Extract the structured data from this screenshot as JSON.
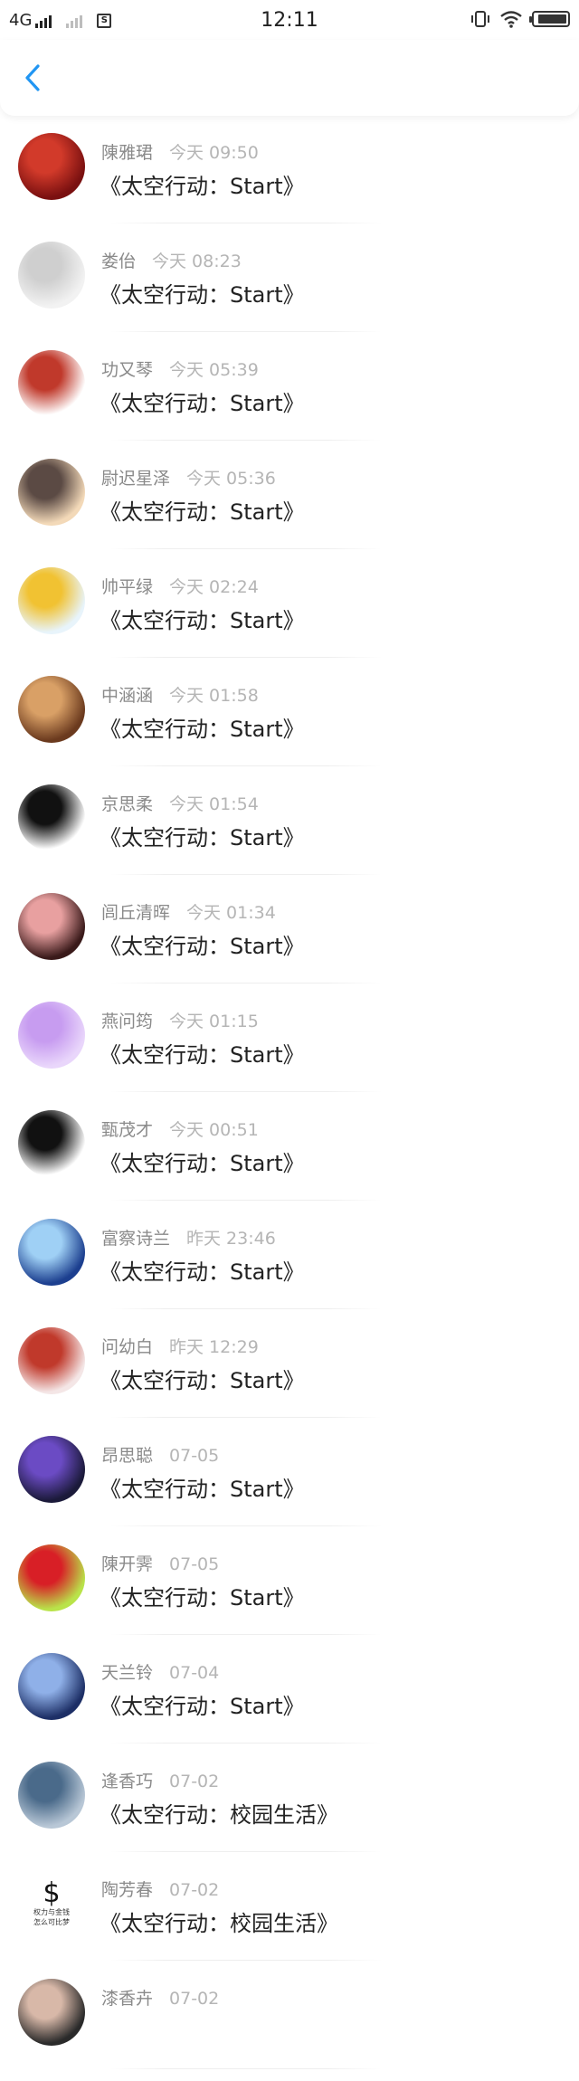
{
  "status_bar": {
    "network": "4G",
    "sim_label": "S",
    "time": "12:11",
    "icons": [
      "vibrate-icon",
      "wifi-icon",
      "battery-icon"
    ],
    "battery_level": 0.92
  },
  "nav": {
    "back_icon": "chevron-left-icon",
    "accent_color": "#2196F3"
  },
  "items": [
    {
      "name": "陳雅珺",
      "time": "今天 09:50",
      "title": "《太空行动：Start》",
      "avatar": "avatar-red-dress",
      "avatar_colors": [
        "#7a1010",
        "#d23a2a"
      ]
    },
    {
      "name": "娄佁",
      "time": "今天 08:23",
      "title": "《太空行动：Start》",
      "avatar": "avatar-pale-photo",
      "avatar_colors": [
        "#f2f2f2",
        "#cfcfcf"
      ]
    },
    {
      "name": "功又琴",
      "time": "今天 05:39",
      "title": "《太空行动：Start》",
      "avatar": "avatar-text-sticker",
      "avatar_colors": [
        "#ffffff",
        "#c0392b"
      ]
    },
    {
      "name": "尉迟星泽",
      "time": "今天 05:36",
      "title": "《太空行动：Start》",
      "avatar": "avatar-cat-cartoon",
      "avatar_colors": [
        "#f3d9b8",
        "#5b4a44"
      ]
    },
    {
      "name": "帅平绿",
      "time": "今天 02:24",
      "title": "《太空行动：Start》",
      "avatar": "avatar-yellow-girl",
      "avatar_colors": [
        "#e8f4fb",
        "#f1c232"
      ]
    },
    {
      "name": "中涵涵",
      "time": "今天 01:58",
      "title": "《太空行动：Start》",
      "avatar": "avatar-latte-art",
      "avatar_colors": [
        "#6b3a1e",
        "#d9a066"
      ]
    },
    {
      "name": "京思柔",
      "time": "今天 01:54",
      "title": "《太空行动：Start》",
      "avatar": "avatar-ink-girl",
      "avatar_colors": [
        "#ffffff",
        "#111111"
      ]
    },
    {
      "name": "闾丘清晖",
      "time": "今天 01:34",
      "title": "《太空行动：Start》",
      "avatar": "avatar-face-closeup",
      "avatar_colors": [
        "#3a1a1a",
        "#e8a0a0"
      ]
    },
    {
      "name": "燕问筠",
      "time": "今天 01:15",
      "title": "《太空行动：Start》",
      "avatar": "avatar-chat-bubble",
      "avatar_colors": [
        "#e9d6fb",
        "#c79cf0"
      ]
    },
    {
      "name": "甄茂才",
      "time": "今天 00:51",
      "title": "《太空行动：Start》",
      "avatar": "avatar-black-skirt",
      "avatar_colors": [
        "#ffffff",
        "#111111"
      ]
    },
    {
      "name": "富察诗兰",
      "time": "昨天 23:46",
      "title": "《太空行动：Start》",
      "avatar": "avatar-ice-princess",
      "avatar_colors": [
        "#1c3f8f",
        "#9fd0f5"
      ]
    },
    {
      "name": "问幼白",
      "time": "昨天 12:29",
      "title": "《太空行动：Start》",
      "avatar": "avatar-cute-kid",
      "avatar_colors": [
        "#f4e6e6",
        "#c0392b"
      ]
    },
    {
      "name": "昂思聪",
      "time": "07-05",
      "title": "《太空行动：Start》",
      "avatar": "avatar-dark-fantasy",
      "avatar_colors": [
        "#1b1a3a",
        "#6b4bc4"
      ]
    },
    {
      "name": "陳开霁",
      "time": "07-05",
      "title": "《太空行动：Start》",
      "avatar": "avatar-headphone-girl",
      "avatar_colors": [
        "#b9e34a",
        "#d81f26"
      ]
    },
    {
      "name": "天兰铃",
      "time": "07-04",
      "title": "《太空行动：Start》",
      "avatar": "avatar-blue-anime",
      "avatar_colors": [
        "#1d2f66",
        "#8fb0e8"
      ]
    },
    {
      "name": "逢香巧",
      "time": "07-02",
      "title": "《太空行动：校园生活》",
      "avatar": "avatar-city-skyline",
      "avatar_colors": [
        "#b8c7d6",
        "#4a6a8a"
      ]
    },
    {
      "name": "陶芳春",
      "time": "07-02",
      "title": "《太空行动：校园生活》",
      "avatar": "avatar-dollar-text",
      "avatar_colors": [
        "#ffffff",
        "#111111"
      ],
      "avatar_text": [
        "权力与金钱",
        "怎么可比梦"
      ]
    },
    {
      "name": "漆香卉",
      "time": "07-02",
      "title": "",
      "avatar": "avatar-dark-portrait",
      "avatar_colors": [
        "#2a2a2a",
        "#d8b8a8"
      ]
    }
  ]
}
